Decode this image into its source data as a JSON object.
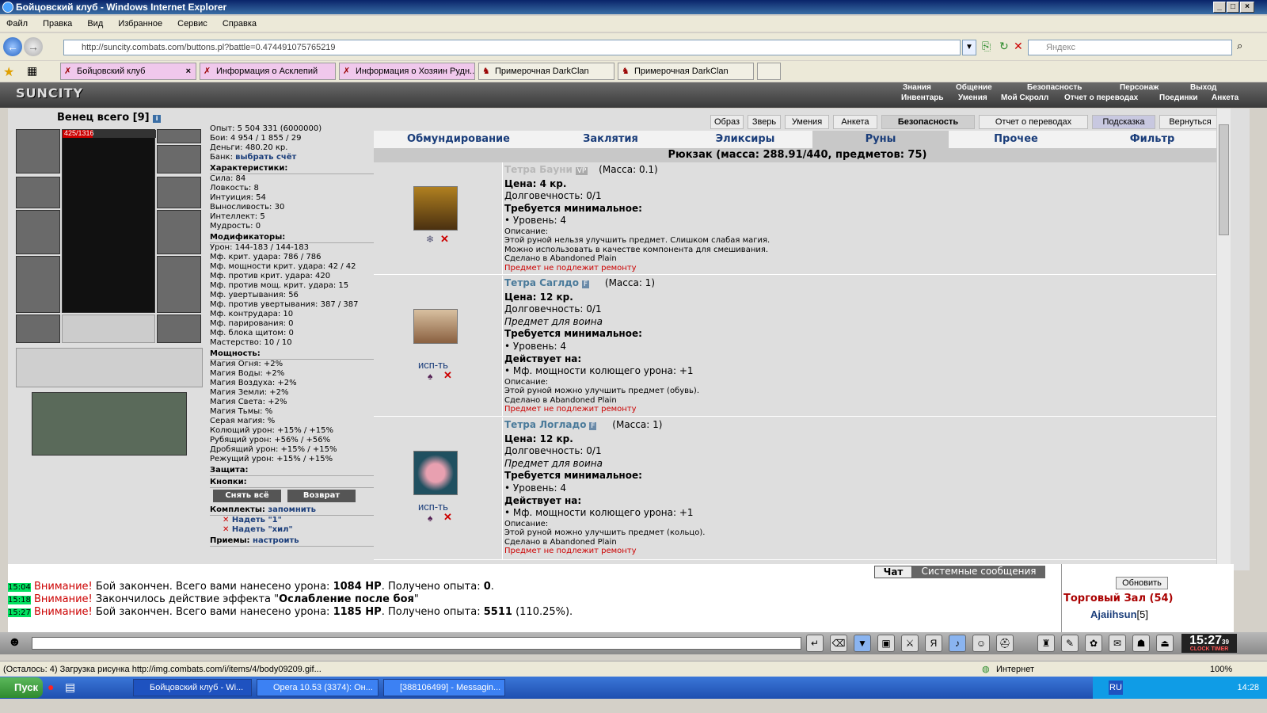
{
  "window": {
    "title": "Бойцовский клуб - Windows Internet Explorer"
  },
  "menu": [
    "Файл",
    "Правка",
    "Вид",
    "Избранное",
    "Сервис",
    "Справка"
  ],
  "address": {
    "url": "http://suncity.combats.com/buttons.pl?battle=0.474491075765219",
    "search_placeholder": "Яндекс"
  },
  "tabs": [
    {
      "label": "Бойцовский клуб",
      "close": "×"
    },
    {
      "label": "Информация о Асклепий"
    },
    {
      "label": "Информация о Хозяин Рудн..."
    },
    {
      "label": "Примерочная DarkClan"
    },
    {
      "label": "Примерочная DarkClan"
    }
  ],
  "game_header": {
    "logo": "SUNCITY",
    "menu_top": [
      "Знания",
      "Общение",
      "Безопасность",
      "Персонаж",
      "Выход"
    ],
    "menu_bottom": [
      "Инвентарь",
      "Умения",
      "Мой Скролл",
      "Отчет о переводах",
      "Поединки",
      "Анкета"
    ]
  },
  "character": {
    "name": "Венец всего [9]",
    "hp": "425/1316",
    "exp": "Опыт: 5 504 331 (6000000)",
    "fights": "Бои: 4 954 / 1 855 / 29",
    "money": "Деньги: 480.20 кр.",
    "bank_label": "Банк:",
    "bank_link": "выбрать счёт",
    "sections": {
      "characteristics": "Характеристики:",
      "modifiers": "Модификаторы:",
      "powers": "Мощность:",
      "defense": "Защита:",
      "buttons": "Кнопки:",
      "sets": "Комплекты:",
      "techniques": "Приемы:"
    },
    "stats": [
      "Сила: 84",
      "Ловкость: 8",
      "Интуиция: 54",
      "Выносливость: 30",
      "Интеллект: 5",
      "Мудрость: 0"
    ],
    "mods": [
      "Урон: 144-183 / 144-183",
      "Мф. крит. удара: 786 / 786",
      "Мф. мощности крит. удара: 42 / 42",
      "Мф. против крит. удара: 420",
      "Мф. против мощ. крит. удара: 15",
      "Мф. увертывания: 56",
      "Мф. против увертывания: 387 / 387",
      "Мф. контрудара: 10",
      "Мф. парирования: 0",
      "Мф. блока щитом: 0",
      "Мастерство: 10 / 10"
    ],
    "powers": [
      "Магия Огня: +2%",
      "Магия Воды: +2%",
      "Магия Воздуха: +2%",
      "Магия Земли: +2%",
      "Магия Света: +2%",
      "Магия Тьмы: %",
      "Серая магия: %",
      "Колющий урон: +15% / +15%",
      "Рубящий урон: +56% / +56%",
      "Дробящий урон: +15% / +15%",
      "Режущий урон: +15% / +15%"
    ],
    "btn_remove_all": "Снять всё",
    "btn_return": "Возврат",
    "sets_link": "запомнить",
    "set1": "Надеть \"1\"",
    "set2": "Надеть \"хил\"",
    "tech_link": "настроить"
  },
  "top_buttons": [
    "Образ",
    "Зверь",
    "Умения",
    "Анкета",
    "Безопасность",
    "Отчет о переводах",
    "Подсказка",
    "Вернуться"
  ],
  "inv_tabs": [
    "Обмундирование",
    "Заклятия",
    "Эликсиры",
    "Руны",
    "Прочее",
    "Фильтр"
  ],
  "bag_title": "Рюкзак (масса: 288.91/440, предметов: 75)",
  "items": [
    {
      "name": "Тетра Бауни",
      "badge": "VP",
      "mass": "(Масса: 0.1)",
      "price": "Цена: 4 кр.",
      "durability": "Долговечность: 0/1",
      "for_warrior": "",
      "req": "Требуется минимальное:",
      "level": "• Уровень: 4",
      "acts": "",
      "effect": "",
      "desc_label": "Описание:",
      "desc1": "Этой руной нельзя улучшить предмет. Слишком слабая магия.",
      "desc2": "Можно использовать в качестве компонента для смешивания.",
      "made": "Сделано в Abandoned Plain",
      "norepair": "Предмет не подлежит ремонту",
      "use": ""
    },
    {
      "name": "Тетра Саглдо",
      "badge": "F",
      "mass": "(Масса: 1)",
      "price": "Цена: 12 кр.",
      "durability": "Долговечность: 0/1",
      "for_warrior": "Предмет для воина",
      "req": "Требуется минимальное:",
      "level": "• Уровень: 4",
      "acts": "Действует на:",
      "effect": "• Мф. мощности колющего урона: +1",
      "desc_label": "Описание:",
      "desc1": "Этой руной можно улучшить предмет (обувь).",
      "desc2": "",
      "made": "Сделано в Abandoned Plain",
      "norepair": "Предмет не подлежит ремонту",
      "use": "исп-ть"
    },
    {
      "name": "Тетра Логладо",
      "badge": "F",
      "mass": "(Масса: 1)",
      "price": "Цена: 12 кр.",
      "durability": "Долговечность: 0/1",
      "for_warrior": "Предмет для воина",
      "req": "Требуется минимальное:",
      "level": "• Уровень: 4",
      "acts": "Действует на:",
      "effect": "• Мф. мощности колющего урона: +1",
      "desc_label": "Описание:",
      "desc1": "Этой руной можно улучшить предмет (кольцо).",
      "desc2": "",
      "made": "Сделано в Abandoned Plain",
      "norepair": "Предмет не подлежит ремонту",
      "use": "исп-ть"
    }
  ],
  "chat": {
    "tab_chat": "Чат",
    "tab_sys": "Системные сообщения",
    "lines": [
      {
        "time": "15:04",
        "attn": "Внимание!",
        "text": "Бой закончен. Всего вами нанесено урона:",
        "bold1": "1084 HP",
        "text2": ". Получено опыта:",
        "bold2": "0",
        "text3": "."
      },
      {
        "time": "15:18",
        "attn": "Внимание!",
        "text": "Закончилось действие эффекта \"",
        "bold1": "Ослабление после боя",
        "text2": "\"",
        "bold2": "",
        "text3": ""
      },
      {
        "time": "15:27",
        "attn": "Внимание!",
        "text": "Бой закончен. Всего вами нанесено урона:",
        "bold1": "1185 HP",
        "text2": ". Получено опыта:",
        "bold2": "5511",
        "text3": "(110.25%)."
      }
    ]
  },
  "online": {
    "refresh": "Обновить",
    "room": "Торговый Зал (54)",
    "user": "Ajaiihsun",
    "user_level": "[5]"
  },
  "clock": {
    "time": "15:27",
    "sec": "39",
    "lbl1": "CLOCK",
    "lbl2": "TIMER"
  },
  "status": {
    "text": "(Осталось: 4) Загрузка рисунка http://img.combats.com/i/items/4/body09209.gif...",
    "zone": "Интернет",
    "zoom": "100%"
  },
  "taskbar": {
    "start": "Пуск",
    "tasks": [
      "Бойцовский клуб - Wi...",
      "Opera 10.53 (3374): Он...",
      "[388106499] - Messagin..."
    ],
    "lang": "RU",
    "time": "14:28"
  },
  "colors": {
    "accent": "#1a3d7a",
    "attention": "#c00000",
    "timestamp_bg": "#00e060",
    "item_name": "#4a7a9a"
  }
}
